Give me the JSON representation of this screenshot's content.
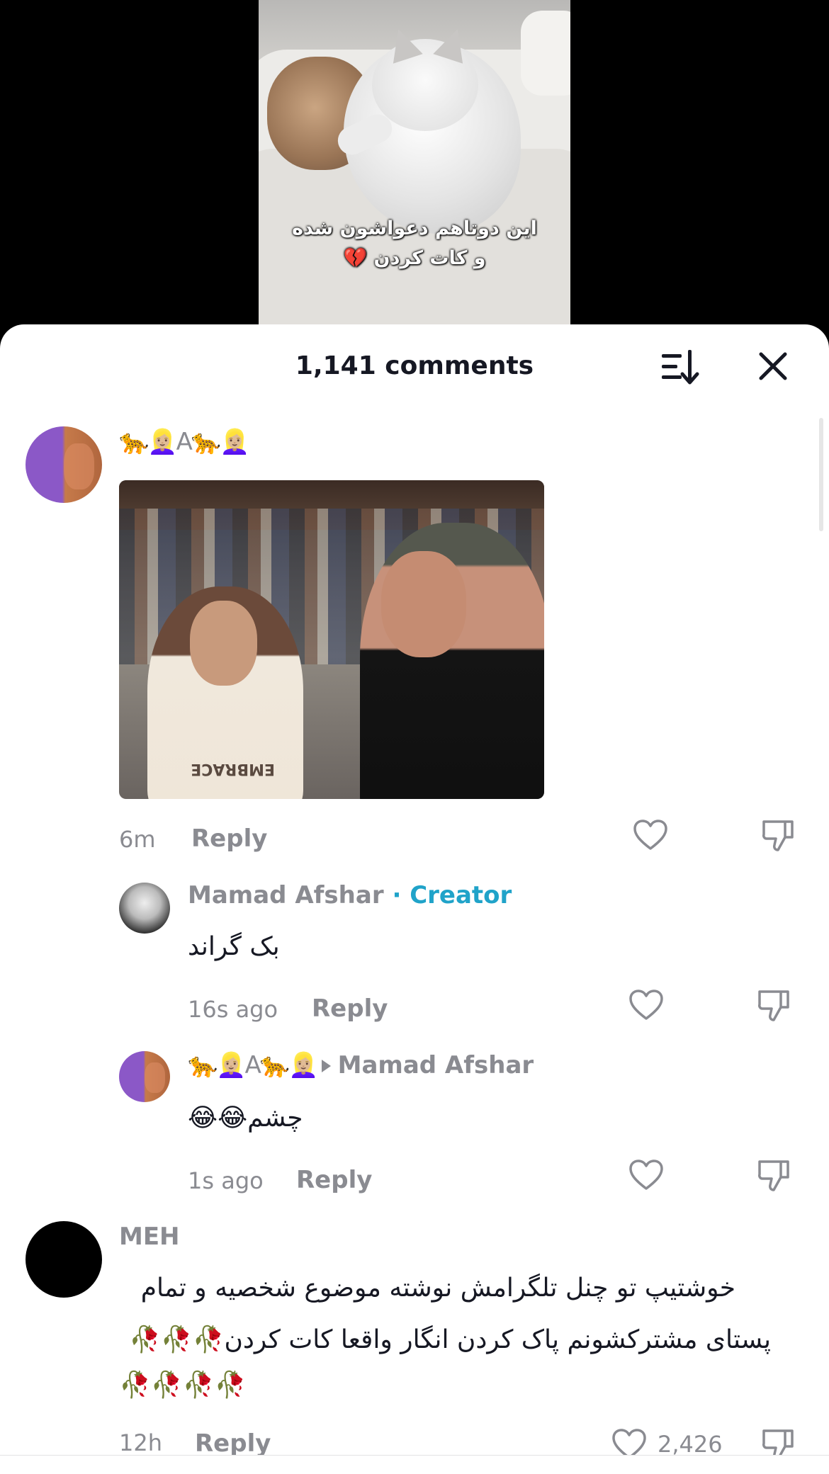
{
  "video": {
    "caption_line1": "این دوتاهم دعواشون شده",
    "caption_line2": "و کات کردن 💔"
  },
  "header": {
    "count_label": "1,141 comments",
    "sort_icon": "sort-icon",
    "close_icon": "close-icon"
  },
  "comments": [
    {
      "username": "🐆👱🏼‍♀️A🐆👱🏼‍♀️",
      "has_image": true,
      "shirt_text": "EMBRACE",
      "time": "6m",
      "reply_label": "Reply",
      "replies": [
        {
          "username": "Mamad Afshar",
          "creator_label": "· Creator",
          "text": "بک گراند",
          "time": "16s ago",
          "reply_label": "Reply"
        },
        {
          "username": "🐆👱🏼‍♀️A🐆👱🏼‍♀️",
          "reply_to": "Mamad Afshar",
          "text": "چشم😂😂",
          "time": "1s ago",
          "reply_label": "Reply"
        }
      ]
    },
    {
      "username": "MEH",
      "text_line1": "خوشتیپ تو چنل تلگرامش نوشته موضوع شخصیه و تمام",
      "text_line2": "پستای مشترکشونم پاک کردن انگار واقعا کات کردن🥀🥀🥀",
      "text_line3": "🥀🥀🥀🥀",
      "time": "12h",
      "reply_label": "Reply",
      "likes": "2,426"
    }
  ],
  "colors": {
    "accent_creator": "#20a3c9",
    "muted": "#8a8b91",
    "text": "#161823"
  }
}
